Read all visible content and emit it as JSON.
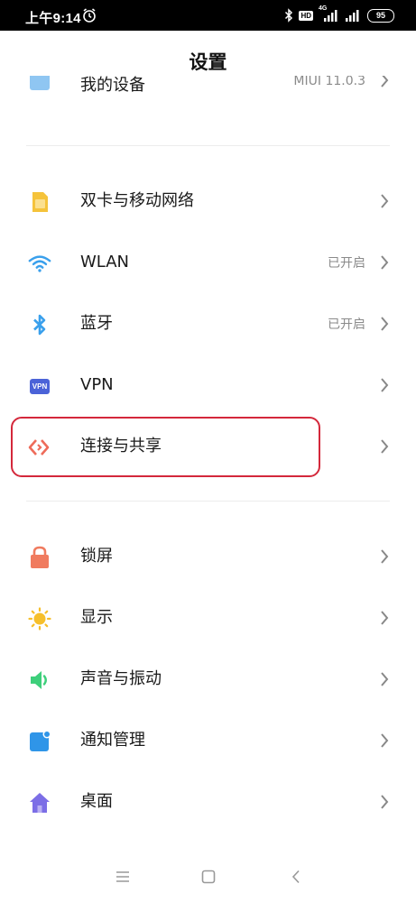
{
  "status_bar": {
    "time": "上午9:14",
    "network": "4G",
    "hd": "HD",
    "battery": "95"
  },
  "header": {
    "title": "设置"
  },
  "partial_item": {
    "label": "我的设备",
    "value": "MIUI 11.0.3"
  },
  "group1": [
    {
      "label": "双卡与移动网络",
      "value": "",
      "icon": "sim-card-icon",
      "color": "#f5c33b"
    },
    {
      "label": "WLAN",
      "value": "已开启",
      "icon": "wifi-icon",
      "color": "#3aa0ec"
    },
    {
      "label": "蓝牙",
      "value": "已开启",
      "icon": "bluetooth-icon",
      "color": "#3aa0ec"
    },
    {
      "label": "VPN",
      "value": "",
      "icon": "vpn-icon",
      "color": "#4b63d8"
    },
    {
      "label": "连接与共享",
      "value": "",
      "icon": "connection-share-icon",
      "color": "#ee6b5a"
    }
  ],
  "group2": [
    {
      "label": "锁屏",
      "icon": "lock-icon",
      "color": "#f07b5f"
    },
    {
      "label": "显示",
      "icon": "sun-icon",
      "color": "#f6bf2b"
    },
    {
      "label": "声音与振动",
      "icon": "speaker-icon",
      "color": "#3ecf7b"
    },
    {
      "label": "通知管理",
      "icon": "notification-icon",
      "color": "#2f95e8"
    },
    {
      "label": "桌面",
      "icon": "home-icon",
      "color": "#7c6ee6"
    }
  ],
  "vpn_badge": "VPN",
  "colors": {
    "highlight": "#d4283b",
    "divider": "#ececec",
    "secondary_text": "#8a8a8a"
  }
}
